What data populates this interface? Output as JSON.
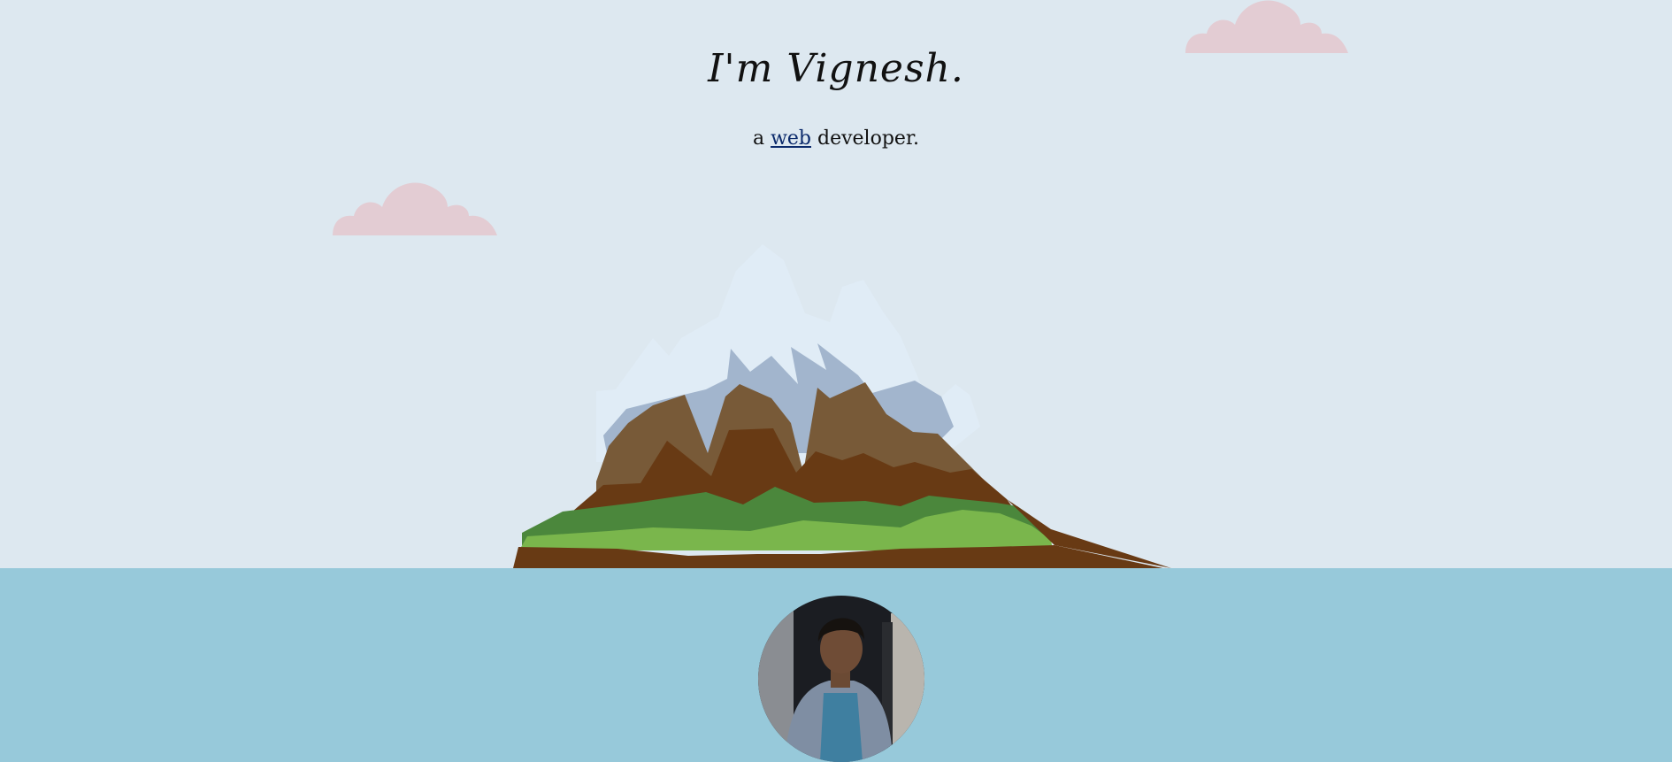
{
  "hero": {
    "name_heading": "I'm Vignesh.",
    "tagline_prefix": "a ",
    "tagline_link": "web",
    "tagline_suffix": " developer."
  },
  "scene": {
    "sky_color": "#dde8f0",
    "sea_color": "#97c9da",
    "cloud_color": "#e3ccd3",
    "illustration": "mountain-island-icon"
  },
  "profile": {
    "avatar": "profile-photo"
  }
}
